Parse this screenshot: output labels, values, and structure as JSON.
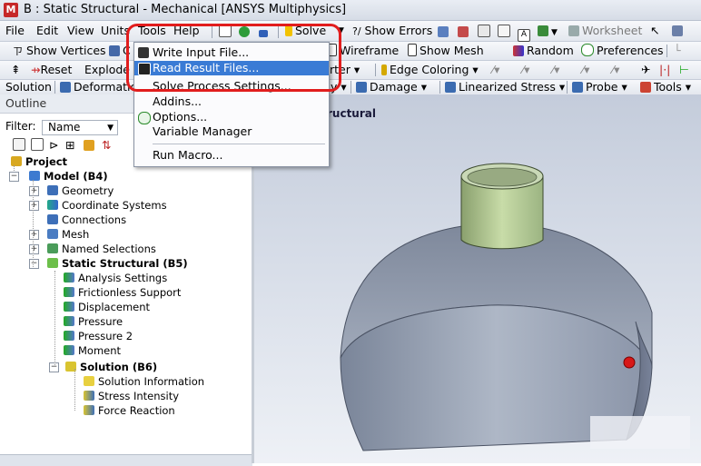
{
  "window": {
    "title": "B : Static Structural - Mechanical [ANSYS Multiphysics]",
    "app_icon_letter": "M"
  },
  "menubar": {
    "file": "File",
    "edit": "Edit",
    "view": "View",
    "units": "Units",
    "tools": "Tools",
    "help": "Help",
    "solve": "Solve",
    "show_errors": "Show Errors",
    "worksheet": "Worksheet"
  },
  "toolbar2": {
    "show_vertices": "Show Vertices",
    "wireframe": "Wireframe",
    "show_mesh": "Show Mesh",
    "random": "Random",
    "preferences": "Preferences"
  },
  "toolbar3": {
    "reset": "Reset",
    "explode": "Explode",
    "edge_coloring": "Edge Coloring"
  },
  "toolbar4": {
    "solution": "Solution",
    "deformation": "Deformatio",
    "damage": "Damage",
    "linearized_stress": "Linearized Stress",
    "probe": "Probe",
    "tools": "Tools"
  },
  "tools_menu": {
    "items": [
      {
        "label": "Write Input File..."
      },
      {
        "label": "Read Result Files...",
        "highlighted": true
      },
      {
        "label": "Solve Process Settings..."
      },
      {
        "label": "Addins..."
      },
      {
        "label": "Options..."
      },
      {
        "label": "Variable Manager"
      },
      {
        "label": "Run Macro..."
      }
    ]
  },
  "outline": {
    "header": "Outline",
    "filter_label": "Filter:",
    "filter_value": "Name",
    "tree": [
      {
        "label": "Project",
        "bold": true
      },
      {
        "label": "Model (B4)",
        "bold": true
      },
      {
        "label": "Geometry"
      },
      {
        "label": "Coordinate Systems"
      },
      {
        "label": "Connections"
      },
      {
        "label": "Mesh"
      },
      {
        "label": "Named Selections"
      },
      {
        "label": "Static Structural (B5)",
        "bold": true
      },
      {
        "label": "Analysis Settings"
      },
      {
        "label": "Frictionless Support"
      },
      {
        "label": "Displacement"
      },
      {
        "label": "Pressure"
      },
      {
        "label": "Pressure 2"
      },
      {
        "label": "Moment"
      },
      {
        "label": "Solution (B6)",
        "bold": true
      },
      {
        "label": "Solution Information"
      },
      {
        "label": "Stress Intensity"
      },
      {
        "label": "Force Reaction"
      }
    ]
  },
  "graphics": {
    "title_fragment": "ructural"
  },
  "colors": {
    "highlight_ring": "#e11d1d",
    "menu_selection": "#3a7bd5"
  }
}
